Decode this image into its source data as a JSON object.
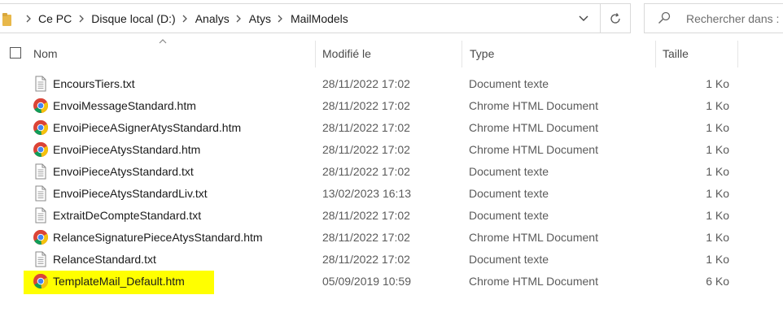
{
  "breadcrumb": [
    "Ce PC",
    "Disque local (D:)",
    "Analys",
    "Atys",
    "MailModels"
  ],
  "search": {
    "placeholder": "Rechercher dans :"
  },
  "columns": {
    "name": "Nom",
    "modified": "Modifié le",
    "type": "Type",
    "size": "Taille"
  },
  "files": [
    {
      "name": "EncoursTiers.txt",
      "modified": "28/11/2022 17:02",
      "type": "Document texte",
      "size": "1 Ko",
      "icon": "text-file-icon"
    },
    {
      "name": "EnvoiMessageStandard.htm",
      "modified": "28/11/2022 17:02",
      "type": "Chrome HTML Document",
      "size": "1 Ko",
      "icon": "chrome-icon"
    },
    {
      "name": "EnvoiPieceASignerAtysStandard.htm",
      "modified": "28/11/2022 17:02",
      "type": "Chrome HTML Document",
      "size": "1 Ko",
      "icon": "chrome-icon"
    },
    {
      "name": "EnvoiPieceAtysStandard.htm",
      "modified": "28/11/2022 17:02",
      "type": "Chrome HTML Document",
      "size": "1 Ko",
      "icon": "chrome-icon"
    },
    {
      "name": "EnvoiPieceAtysStandard.txt",
      "modified": "28/11/2022 17:02",
      "type": "Document texte",
      "size": "1 Ko",
      "icon": "text-file-icon"
    },
    {
      "name": "EnvoiPieceAtysStandardLiv.txt",
      "modified": "13/02/2023 16:13",
      "type": "Document texte",
      "size": "1 Ko",
      "icon": "text-file-icon"
    },
    {
      "name": "ExtraitDeCompteStandard.txt",
      "modified": "28/11/2022 17:02",
      "type": "Document texte",
      "size": "1 Ko",
      "icon": "text-file-icon"
    },
    {
      "name": "RelanceSignaturePieceAtysStandard.htm",
      "modified": "28/11/2022 17:02",
      "type": "Chrome HTML Document",
      "size": "1 Ko",
      "icon": "chrome-icon"
    },
    {
      "name": "RelanceStandard.txt",
      "modified": "28/11/2022 17:02",
      "type": "Document texte",
      "size": "1 Ko",
      "icon": "text-file-icon"
    },
    {
      "name": "TemplateMail_Default.htm",
      "modified": "05/09/2019 10:59",
      "type": "Chrome HTML Document",
      "size": "6 Ko",
      "icon": "chrome-icon",
      "highlighted": true
    }
  ],
  "colors": {
    "highlight": "#ffff00",
    "folder": "#e8b84a"
  }
}
